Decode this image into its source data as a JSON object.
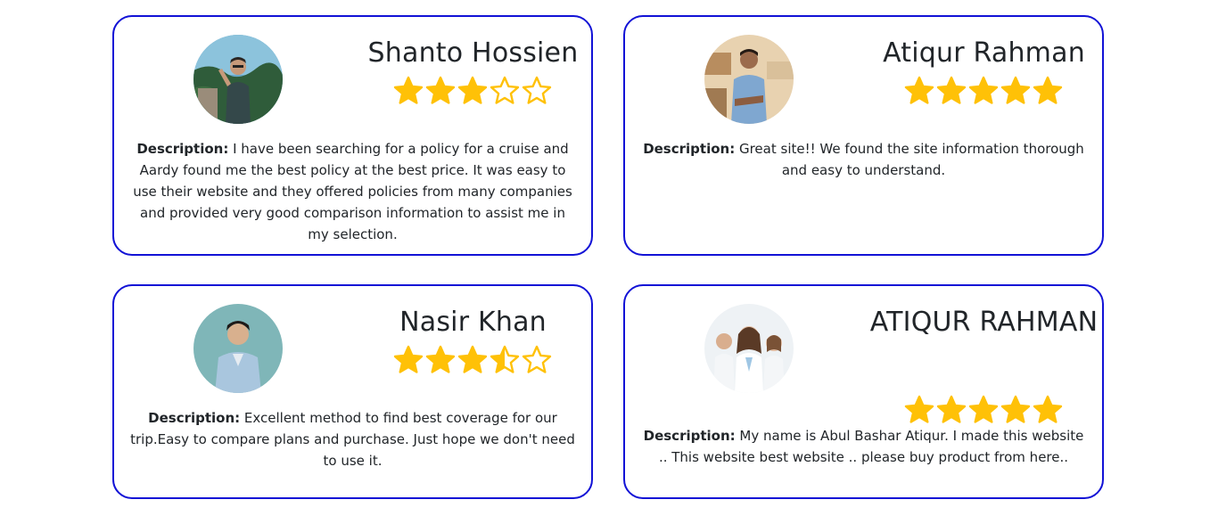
{
  "reviews": [
    {
      "name": "Shanto Hossien",
      "rating": 3,
      "avatar_icon": "user-avatar-photo",
      "desc_label": "Description:",
      "desc_text": " I have been searching for a policy for a cruise and Aardy found me the best policy at the best price. It was easy to use their website and they offered policies from many companies and provided very good comparison information to assist me in my selection."
    },
    {
      "name": "Atiqur Rahman",
      "rating": 5,
      "avatar_icon": "user-avatar-photo",
      "desc_label": "Description:",
      "desc_text": " Great site!! We found the site information thorough and easy to understand."
    },
    {
      "name": "Nasir Khan",
      "rating": 3.5,
      "avatar_icon": "user-avatar-photo",
      "desc_label": "Description:",
      "desc_text": " Excellent method to find best coverage for our trip.Easy to compare plans and purchase. Just hope we don't need to use it."
    },
    {
      "name": "ATIQUR RAHMAN",
      "rating": 5,
      "avatar_icon": "group-avatar-photo",
      "desc_label": "Description:",
      "desc_text": " My name is Abul Bashar Atiqur. I made this website .. This website best website .. please buy product from here.."
    }
  ],
  "colors": {
    "card_border": "#1212d6",
    "star": "#ffc107",
    "text": "#212529"
  }
}
